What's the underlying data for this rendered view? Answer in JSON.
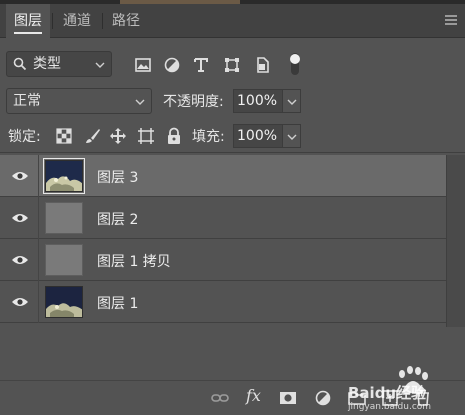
{
  "tabs": [
    {
      "label": "图层",
      "active": true
    },
    {
      "label": "通道",
      "active": false
    },
    {
      "label": "路径",
      "active": false
    }
  ],
  "filter": {
    "kind_label": "类型",
    "icons": [
      "image-filter-icon",
      "adjustment-filter-icon",
      "type-filter-icon",
      "shape-filter-icon",
      "smart-object-filter-icon",
      "filter-toggle-icon"
    ]
  },
  "blend": {
    "mode": "正常",
    "opacity_label": "不透明度:",
    "opacity_value": "100%"
  },
  "lock": {
    "label": "锁定:",
    "icons": [
      "lock-transparent-pixels-icon",
      "lock-image-pixels-icon",
      "lock-position-icon",
      "lock-artboard-icon",
      "lock-all-icon"
    ],
    "fill_label": "填充:",
    "fill_value": "100%"
  },
  "layers": [
    {
      "name": "图层 3",
      "thumb": "photo",
      "selected": true
    },
    {
      "name": "图层 2",
      "thumb": "gray",
      "selected": false
    },
    {
      "name": "图层 1 拷贝",
      "thumb": "gray",
      "selected": false
    },
    {
      "name": "图层 1",
      "thumb": "photo",
      "selected": false
    }
  ],
  "bottom_icons": [
    "link-layers-icon",
    "fx-icon",
    "add-mask-icon",
    "adjustment-layer-icon",
    "new-group-icon",
    "new-layer-icon",
    "delete-layer-icon"
  ],
  "bottom_fx_label": "fx",
  "watermark_text": "Baidu经验",
  "watermark_sub": "jingyan.baidu.com",
  "colors": {
    "panel": "#535353",
    "tabbar": "#424242",
    "selected_row": "#6a6a6a"
  }
}
